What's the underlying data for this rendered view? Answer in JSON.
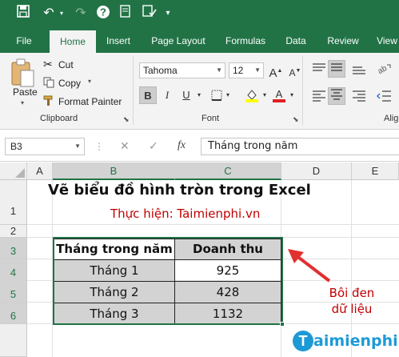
{
  "ribbon_tabs": [
    "File",
    "Home",
    "Insert",
    "Page Layout",
    "Formulas",
    "Data",
    "Review",
    "View"
  ],
  "clipboard": {
    "paste": "Paste",
    "cut": "Cut",
    "copy": "Copy",
    "format_painter": "Format Painter",
    "group_label": "Clipboard"
  },
  "font": {
    "name": "Tahoma",
    "size": "12",
    "group_label": "Font"
  },
  "alignment": {
    "group_label_partial": "Alig"
  },
  "formula_bar": {
    "name_box": "B3",
    "fx": "fx",
    "content": "Tháng trong năm"
  },
  "columns": [
    "A",
    "B",
    "C",
    "D",
    "E"
  ],
  "rows": [
    "1",
    "2",
    "3",
    "4",
    "5",
    "6"
  ],
  "sheet": {
    "title": "Vẽ biểu đồ hình tròn trong Excel",
    "subtitle": "Thực hiện: Taimienphi.vn",
    "table": {
      "headers": [
        "Tháng trong năm",
        "Doanh thu"
      ],
      "rows": [
        [
          "Tháng 1",
          "925"
        ],
        [
          "Tháng 2",
          "428"
        ],
        [
          "Tháng 3",
          "1132"
        ]
      ]
    }
  },
  "annotation": {
    "line1": "Bôi đen",
    "line2": "dữ liệu"
  },
  "watermark": "Taimienphi",
  "colors": {
    "excel_green": "#217346",
    "annotation_red": "#c00000",
    "cell_grey": "#d3d3d3"
  }
}
